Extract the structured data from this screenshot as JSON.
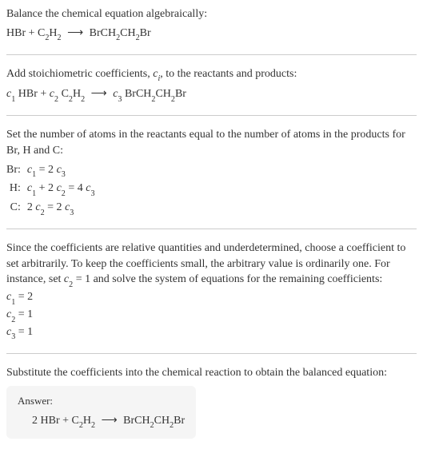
{
  "section1": {
    "instruction_prefix": "Balance the chemical equation algebraically:",
    "lhs_1": "HBr",
    "plus_1": " + ",
    "lhs_2a": "C",
    "lhs_2b": "2",
    "lhs_2c": "H",
    "lhs_2d": "2",
    "arrow": "⟶",
    "rhs_1a": "BrCH",
    "rhs_1b": "2",
    "rhs_1c": "CH",
    "rhs_1d": "2",
    "rhs_1e": "Br"
  },
  "section2": {
    "text_a": "Add stoichiometric coefficients, ",
    "text_b": "c",
    "text_c": "i",
    "text_d": ", to the reactants and products:",
    "c1a": "c",
    "c1b": "1",
    "sp1": " HBr",
    "plus": " + ",
    "c2a": "c",
    "c2b": "2",
    "sp2a": " C",
    "sp2b": "2",
    "sp2c": "H",
    "sp2d": "2",
    "arrow": "⟶",
    "c3a": "c",
    "c3b": "3",
    "sp3a": " BrCH",
    "sp3b": "2",
    "sp3c": "CH",
    "sp3d": "2",
    "sp3e": "Br"
  },
  "section3": {
    "text": "Set the number of atoms in the reactants equal to the number of atoms in the products for Br, H and C:",
    "rows": [
      {
        "label": "Br:",
        "eq_c1a": "c",
        "eq_c1b": "1",
        "eq_mid": " = 2 ",
        "eq_c2a": "c",
        "eq_c2b": "3"
      },
      {
        "label": "H:",
        "eq_c1a": "c",
        "eq_c1b": "1",
        "eq_mid1": " + 2 ",
        "eq_c2a": "c",
        "eq_c2b": "2",
        "eq_mid2": " = 4 ",
        "eq_c3a": "c",
        "eq_c3b": "3"
      },
      {
        "label": "C:",
        "eq_pre": "2 ",
        "eq_c1a": "c",
        "eq_c1b": "2",
        "eq_mid": " = 2 ",
        "eq_c2a": "c",
        "eq_c2b": "3"
      }
    ]
  },
  "section4": {
    "text_a": "Since the coefficients are relative quantities and underdetermined, choose a coefficient to set arbitrarily. To keep the coefficients small, the arbitrary value is ordinarily one. For instance, set ",
    "text_b": "c",
    "text_c": "2",
    "text_d": " = 1 and solve the system of equations for the remaining coefficients:",
    "r1a": "c",
    "r1b": "1",
    "r1c": " = 2",
    "r2a": "c",
    "r2b": "2",
    "r2c": " = 1",
    "r3a": "c",
    "r3b": "3",
    "r3c": " = 1"
  },
  "section5": {
    "text": "Substitute the coefficients into the chemical reaction to obtain the balanced equation:",
    "answer_label": "Answer:",
    "eq_a": "2 HBr",
    "eq_plus": " + ",
    "eq_b1": "C",
    "eq_b2": "2",
    "eq_b3": "H",
    "eq_b4": "2",
    "arrow": "⟶",
    "eq_c1": "BrCH",
    "eq_c2": "2",
    "eq_c3": "CH",
    "eq_c4": "2",
    "eq_c5": "Br"
  },
  "chart_data": {
    "type": "table",
    "title": "Balancing chemical equation algebraically",
    "unbalanced_equation": "HBr + C2H2 → BrCH2CH2Br",
    "stoichiometric_form": "c1 HBr + c2 C2H2 → c3 BrCH2CH2Br",
    "atom_balance_equations": {
      "Br": "c1 = 2 c3",
      "H": "c1 + 2 c2 = 4 c3",
      "C": "2 c2 = 2 c3"
    },
    "arbitrary_choice": "c2 = 1",
    "solved_coefficients": {
      "c1": 2,
      "c2": 1,
      "c3": 1
    },
    "balanced_equation": "2 HBr + C2H2 → BrCH2CH2Br"
  }
}
